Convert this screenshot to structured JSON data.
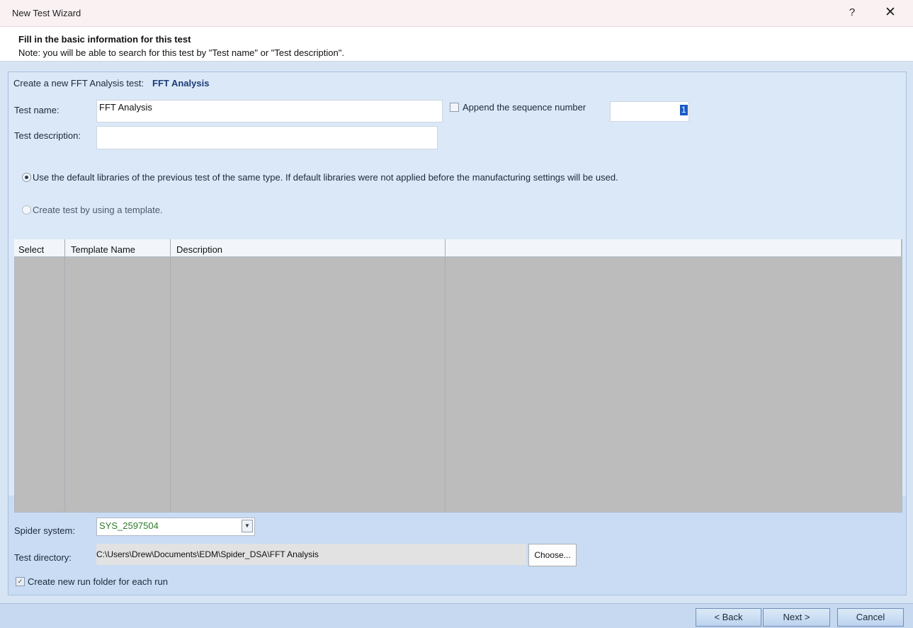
{
  "window": {
    "title": "New Test Wizard",
    "help_icon": "?",
    "close_icon": "✕"
  },
  "header": {
    "title": "Fill in the basic information for this test",
    "note": "Note: you will be able to search for this test by \"Test name\" or \"Test description\"."
  },
  "form": {
    "create_line": "Create a new FFT Analysis test:",
    "test_type": "FFT Analysis",
    "test_name_label": "Test name:",
    "test_name_value": "FFT Analysis",
    "append_label": "Append the sequence number",
    "append_checked": false,
    "sequence_value": "1",
    "test_description_label": "Test description:",
    "test_description_value": "",
    "radio_default_label": "Use the default libraries of the previous test of the same type. If default libraries were not applied before the manufacturing settings will be used.",
    "radio_template_label": "Create test by using a template."
  },
  "template_table": {
    "columns": [
      "Select",
      "Template Name",
      "Description"
    ],
    "rows": []
  },
  "bottom": {
    "spider_label": "Spider system:",
    "spider_value": "SYS_2597504",
    "dir_label": "Test directory:",
    "dir_value": "C:\\Users\\Drew\\Documents\\EDM\\Spider_DSA\\FFT Analysis",
    "choose_label": "Choose...",
    "run_folder_label": "Create new run folder for each run",
    "run_folder_checked": true
  },
  "footer": {
    "back_label": "< Back",
    "next_label": "Next >",
    "cancel_label": "Cancel"
  }
}
